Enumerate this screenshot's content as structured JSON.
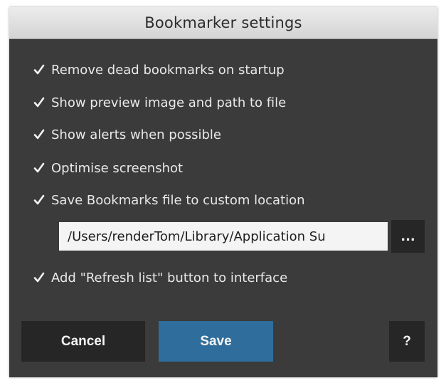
{
  "window": {
    "title": "Bookmarker settings"
  },
  "options": [
    {
      "label": "Remove dead bookmarks on startup",
      "checked": true
    },
    {
      "label": "Show preview image and path to file",
      "checked": true
    },
    {
      "label": "Show alerts when possible",
      "checked": true
    },
    {
      "label": "Optimise screenshot",
      "checked": true
    },
    {
      "label": "Save Bookmarks file to custom location",
      "checked": true
    },
    {
      "label": "Add \"Refresh list\" button to interface",
      "checked": true
    }
  ],
  "custom_location": {
    "value": "/Users/renderTom/Library/Application Su",
    "browse_label": "..."
  },
  "buttons": {
    "cancel": "Cancel",
    "save": "Save",
    "help": "?"
  },
  "colors": {
    "panel_bg": "#3b3b3b",
    "button_bg": "#262626",
    "accent": "#2f6d9c",
    "text": "#e9e9e9"
  },
  "icons": {
    "checkbox": "checkmark-icon"
  }
}
